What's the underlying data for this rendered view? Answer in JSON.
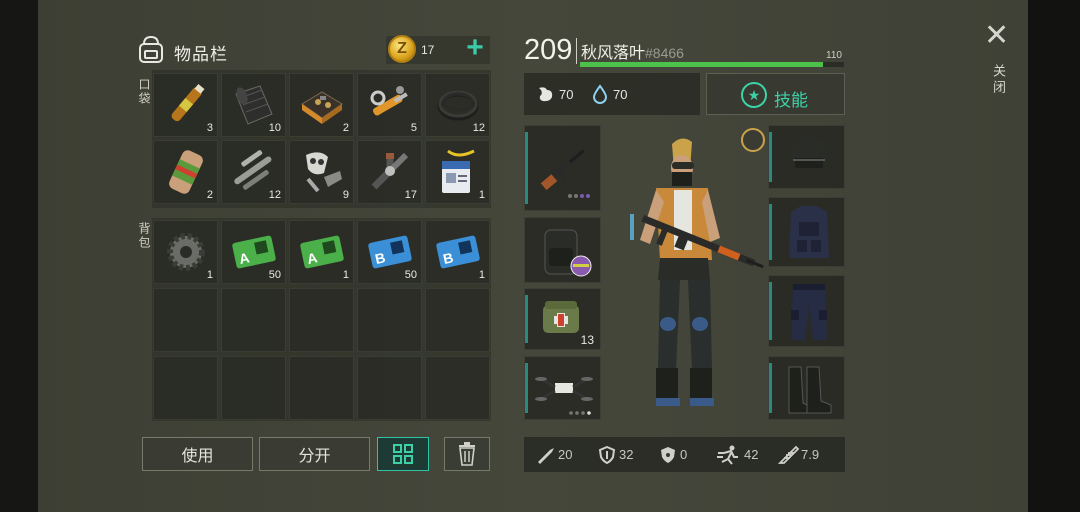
{
  "inventory": {
    "title": "物品栏",
    "coin_icon": "Z",
    "coins": "17",
    "add_button": "+",
    "pocket_label": "口袋",
    "backpack_label": "背包",
    "pocket_items": [
      {
        "icon": "ampoule-icon",
        "qty": "3"
      },
      {
        "icon": "fabric-roll-icon",
        "qty": "10"
      },
      {
        "icon": "circuit-board-icon",
        "qty": "2"
      },
      {
        "icon": "mechanical-parts-icon",
        "qty": "5"
      },
      {
        "icon": "rubber-hose-icon",
        "qty": "12"
      },
      {
        "icon": "canned-food-icon",
        "qty": "2"
      },
      {
        "icon": "metal-pipes-icon",
        "qty": "12"
      },
      {
        "icon": "mask-scrap-icon",
        "qty": "9"
      },
      {
        "icon": "pipe-parts-icon",
        "qty": "17"
      },
      {
        "icon": "id-badge-icon",
        "qty": "1"
      }
    ],
    "backpack_items": [
      {
        "icon": "gear-icon",
        "qty": "1"
      },
      {
        "icon": "sector-a-card-icon",
        "qty": "50",
        "letter": "A"
      },
      {
        "icon": "sector-a-card-icon",
        "qty": "1",
        "letter": "A"
      },
      {
        "icon": "sector-b-card-icon",
        "qty": "50",
        "letter": "B"
      },
      {
        "icon": "sector-b-card-icon",
        "qty": "1",
        "letter": "B"
      }
    ],
    "buttons": {
      "use": "使用",
      "split": "分开"
    }
  },
  "character": {
    "level": "209",
    "name": "秋风落叶",
    "id_tag": "#8466",
    "hp_max": "110",
    "hp_fraction": 0.92,
    "food": "70",
    "water": "70",
    "skill_label": "技能",
    "medkit_qty": "13",
    "stats": {
      "attack": "20",
      "defense": "32",
      "radiation": "0",
      "speed": "42",
      "weight": "7.9"
    }
  },
  "close_label": "关闭",
  "colors": {
    "accent": "#3dd2a6",
    "hp": "#4cc24a",
    "coin": "#e0b02a",
    "card_a": "#4bb04a",
    "card_b": "#3b8fd6"
  }
}
